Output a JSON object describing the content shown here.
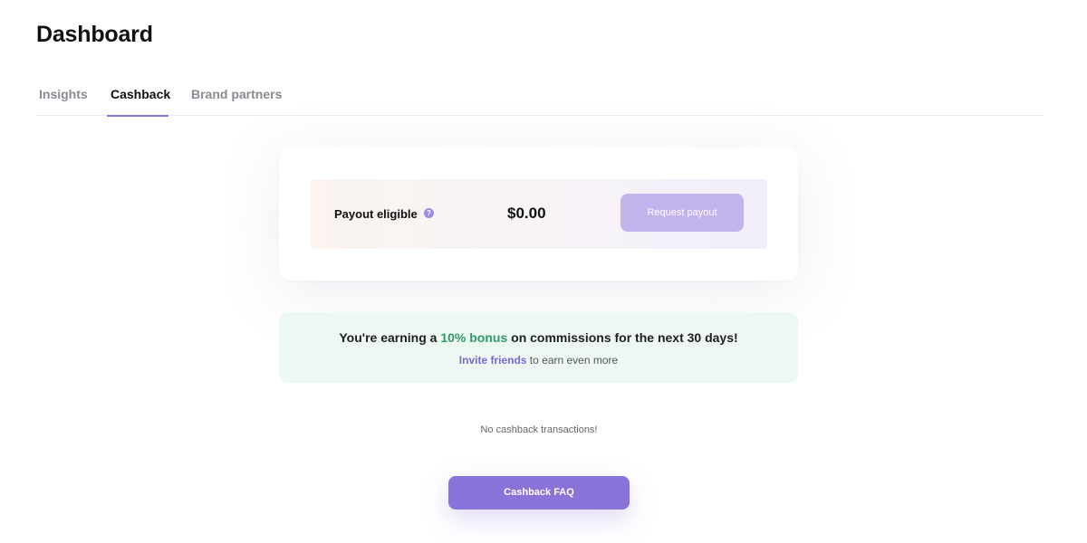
{
  "header": {
    "title": "Dashboard"
  },
  "tabs": [
    {
      "label": "Insights",
      "active": false
    },
    {
      "label": "Cashback",
      "active": true
    },
    {
      "label": "Brand partners",
      "active": false
    }
  ],
  "payout": {
    "label": "Payout eligible",
    "info_icon": "info-icon",
    "amount": "$0.00",
    "button_label": "Request payout"
  },
  "bonus_banner": {
    "prefix": "You're earning a ",
    "highlight": "10% bonus",
    "suffix": " on commissions for the next 30 days!",
    "invite_link": "Invite friends",
    "invite_suffix": " to earn even more"
  },
  "transactions": {
    "empty_message": "No cashback transactions!"
  },
  "faq": {
    "button_label": "Cashback FAQ"
  },
  "colors": {
    "accent": "#8a73d8",
    "tab_underline": "#8c76dc",
    "bonus_green": "#2f9b6a",
    "banner_bg": "#eef8f3",
    "request_button_bg": "#c1b3ec"
  }
}
